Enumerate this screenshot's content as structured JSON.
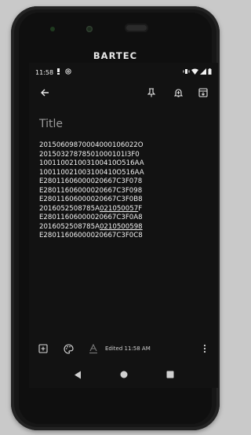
{
  "device": {
    "brand": "BARTEC"
  },
  "status_bar": {
    "time": "11:58"
  },
  "toolbar": {
    "back_icon": "arrow-left-icon",
    "pin_icon": "pin-icon",
    "reminder_icon": "bell-plus-icon",
    "archive_icon": "archive-icon"
  },
  "note": {
    "title_placeholder": "Title",
    "lines": [
      {
        "text": "20150609870004000106022O",
        "underline": ""
      },
      {
        "text": "20150327878501000101I3F0",
        "underline": ""
      },
      {
        "text": "100110021003100410O516AA",
        "underline": ""
      },
      {
        "text": "100110021003100410O516AA",
        "underline": ""
      },
      {
        "text": "E28011606000020667C3F078",
        "underline": ""
      },
      {
        "text": "E28011606000020667C3F098",
        "underline": ""
      },
      {
        "text": "E28011606000020667C3F0B8",
        "underline": ""
      },
      {
        "pre": "2016052508785A",
        "underline": "021050057",
        "post": "F"
      },
      {
        "text": "E28011606000020667C3F0A8",
        "underline": ""
      },
      {
        "pre": "2016052508785A",
        "underline": "0210500598",
        "post": ""
      },
      {
        "text": "E28011606000020667C3F0C8",
        "underline": ""
      }
    ]
  },
  "bottom_bar": {
    "add_icon": "add-box-icon",
    "palette_icon": "palette-icon",
    "text_format_icon": "text-format-icon",
    "edited_label": "Edited 11:58 AM",
    "more_icon": "more-vertical-icon"
  },
  "nav_bar": {
    "back": "nav-back-icon",
    "home": "nav-home-icon",
    "recents": "nav-recents-icon"
  }
}
